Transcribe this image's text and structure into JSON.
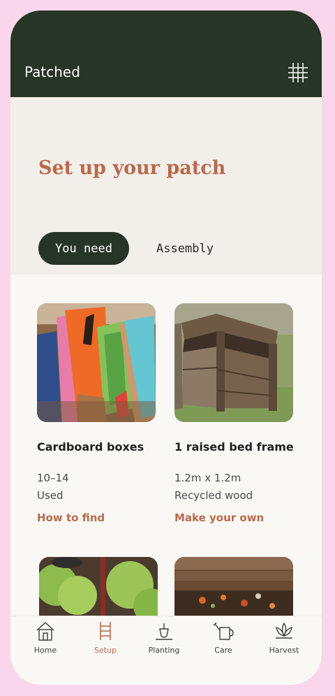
{
  "app": {
    "title": "Patched"
  },
  "page": {
    "title": "Set up your patch"
  },
  "tabs": [
    {
      "label": "You need",
      "active": true
    },
    {
      "label": "Assembly",
      "active": false
    }
  ],
  "items": [
    {
      "name": "Cardboard boxes",
      "quantity": "10–14",
      "condition": "Used",
      "link": "How to find",
      "image": "cardboard-boxes-photo"
    },
    {
      "name": "1 raised bed frame",
      "quantity": "1.2m x 1.2m",
      "condition": "Recycled wood",
      "link": "Make your own",
      "image": "raised-bed-photo"
    }
  ],
  "more_images": [
    "seedlings-photo",
    "compost-photo"
  ],
  "nav": [
    {
      "label": "Home",
      "icon": "house-icon",
      "active": false
    },
    {
      "label": "Setup",
      "icon": "ladder-icon",
      "active": true
    },
    {
      "label": "Planting",
      "icon": "trowel-icon",
      "active": false
    },
    {
      "label": "Care",
      "icon": "watering-can-icon",
      "active": false
    },
    {
      "label": "Harvest",
      "icon": "lotus-icon",
      "active": false
    }
  ],
  "colors": {
    "header": "#273526",
    "accent": "#b9694a",
    "hero_bg": "#f2efeb",
    "frame": "#f9d6ec"
  }
}
